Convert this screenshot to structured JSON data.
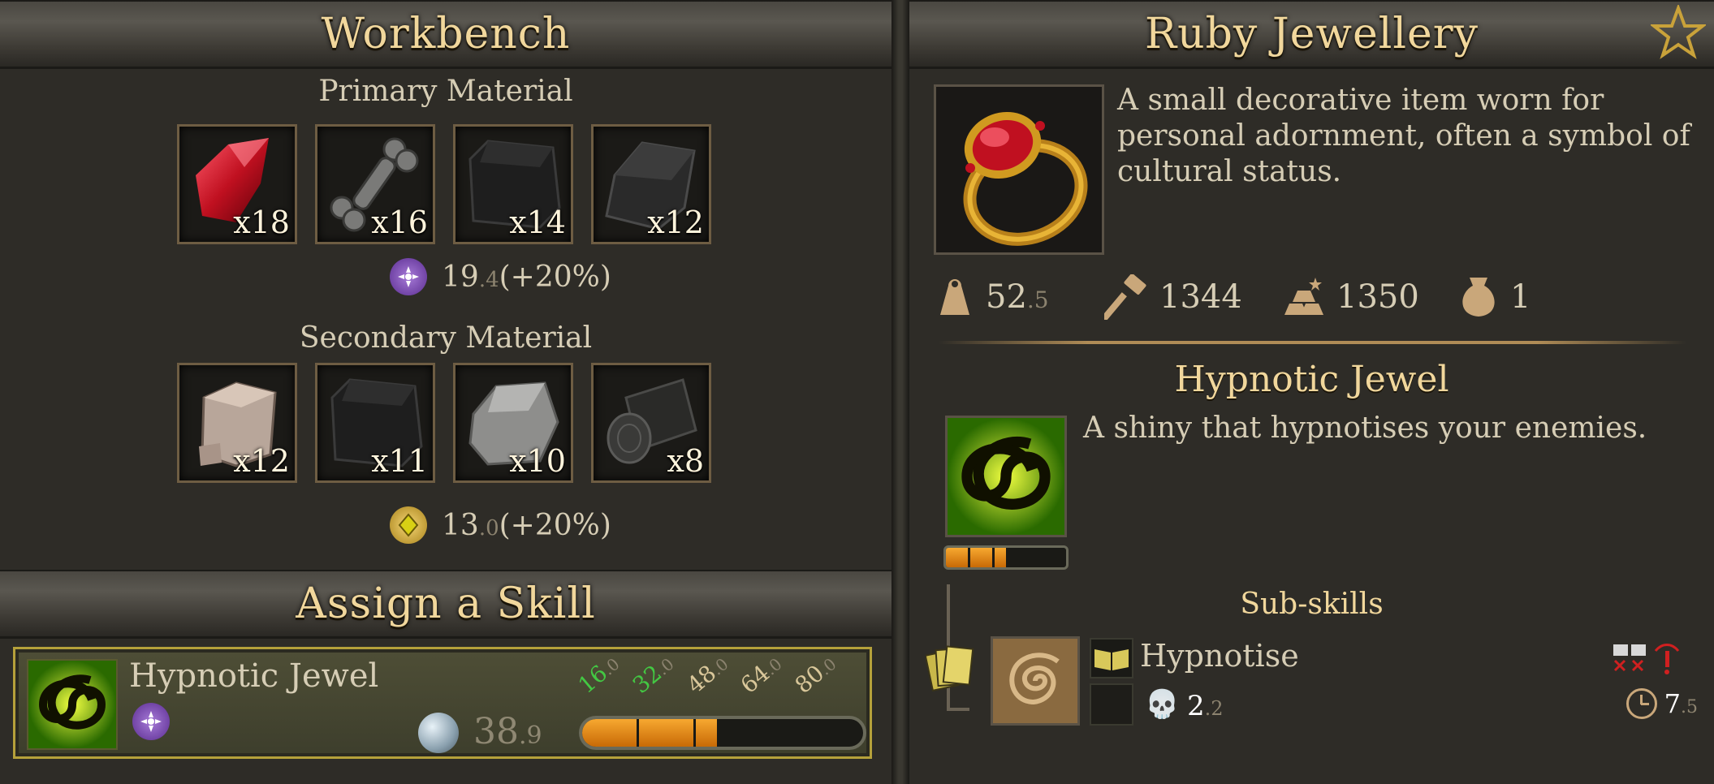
{
  "workbench": {
    "title": "Workbench",
    "primary": {
      "label": "Primary Material",
      "materials": [
        {
          "icon": "ruby-gem-icon",
          "count": "x18"
        },
        {
          "icon": "bone-icon",
          "count": "x16"
        },
        {
          "icon": "dark-leather-icon",
          "count": "x14"
        },
        {
          "icon": "iron-ingot-icon",
          "count": "x12"
        }
      ],
      "stat": {
        "icon": "arcane-icon",
        "value": "19",
        "decimal": ".4",
        "bonus": "(+20%)"
      }
    },
    "secondary": {
      "label": "Secondary Material",
      "materials": [
        {
          "icon": "stone-block-icon",
          "count": "x12"
        },
        {
          "icon": "dark-leather-icon",
          "count": "x11"
        },
        {
          "icon": "grey-rock-icon",
          "count": "x10"
        },
        {
          "icon": "log-icon",
          "count": "x8"
        }
      ],
      "stat": {
        "icon": "gold-diamond-icon",
        "value": "13",
        "decimal": ".0",
        "bonus": "(+20%)"
      }
    }
  },
  "assign_skill": {
    "title": "Assign a Skill",
    "skill_name": "Hypnotic Jewel",
    "orb_value": "38",
    "orb_decimal": ".9",
    "ticks": [
      {
        "value": "16",
        "decimal": ".0",
        "color": "#43c843"
      },
      {
        "value": "32",
        "decimal": ".0",
        "color": "#43c843"
      },
      {
        "value": "48",
        "decimal": ".0",
        "color": "#d9c79a"
      },
      {
        "value": "64",
        "decimal": ".0",
        "color": "#d9c79a"
      },
      {
        "value": "80",
        "decimal": ".0",
        "color": "#d9c79a"
      }
    ],
    "progress": 0.48
  },
  "item": {
    "title": "Ruby Jewellery",
    "description": "A small decorative item worn for personal adornment, often a symbol of cultural status.",
    "props": [
      {
        "icon": "weight-icon",
        "value": "52",
        "decimal": ".5"
      },
      {
        "icon": "hammer-icon",
        "value": "1344",
        "decimal": ""
      },
      {
        "icon": "gold-bars-icon",
        "value": "1350",
        "decimal": ""
      },
      {
        "icon": "money-bag-icon",
        "value": "1",
        "decimal": ""
      }
    ],
    "skill": {
      "name": "Hypnotic Jewel",
      "description": "A shiny that hypnotises your enemies.",
      "level_segments_filled": 2.5,
      "level_segments_total": 5,
      "subskills_label": "Sub-skills",
      "subskill": {
        "name": "Hypnotise",
        "damage": "2",
        "damage_decimal": ".2",
        "cooldown": "7",
        "cooldown_decimal": ".5"
      }
    }
  },
  "colors": {
    "title_gold": "#f1d79c",
    "progress_orange": "#e28a12",
    "frame_gold": "#b5a13a"
  }
}
